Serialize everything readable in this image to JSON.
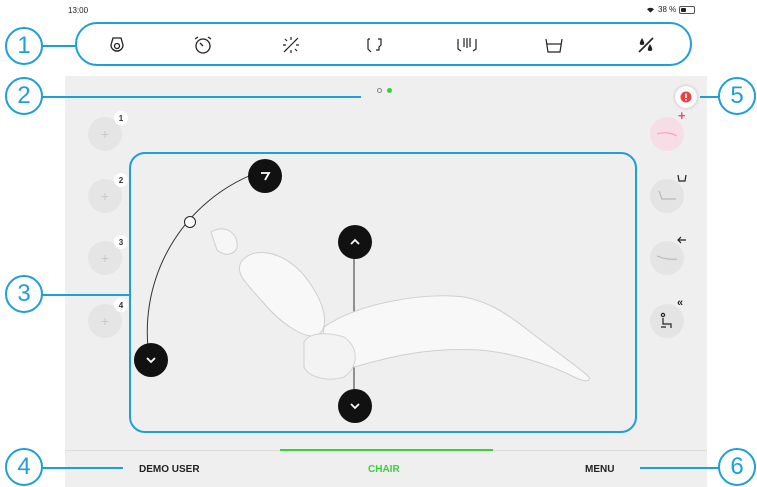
{
  "status": {
    "time": "13:00",
    "battery": "38 %",
    "battery_level": 0.38
  },
  "toolbar": {
    "items": [
      {
        "icon": "light-icon"
      },
      {
        "icon": "timer-icon"
      },
      {
        "icon": "lamp-off-icon"
      },
      {
        "icon": "instruments-icon"
      },
      {
        "icon": "suction-icon"
      },
      {
        "icon": "cup-fill-icon"
      },
      {
        "icon": "water-off-icon"
      }
    ]
  },
  "callouts": [
    "1",
    "2",
    "3",
    "4",
    "5",
    "6"
  ],
  "pager": {
    "pages": 2,
    "active": 2
  },
  "presets": [
    "1",
    "2",
    "3",
    "4"
  ],
  "tabs": {
    "user": "DEMO USER",
    "chair": "CHAIR",
    "menu": "MENU"
  },
  "colors": {
    "accent": "#1e9fd8",
    "active": "#3ccf3c",
    "alert": "#e84343",
    "pink": "#f4a3c0"
  }
}
